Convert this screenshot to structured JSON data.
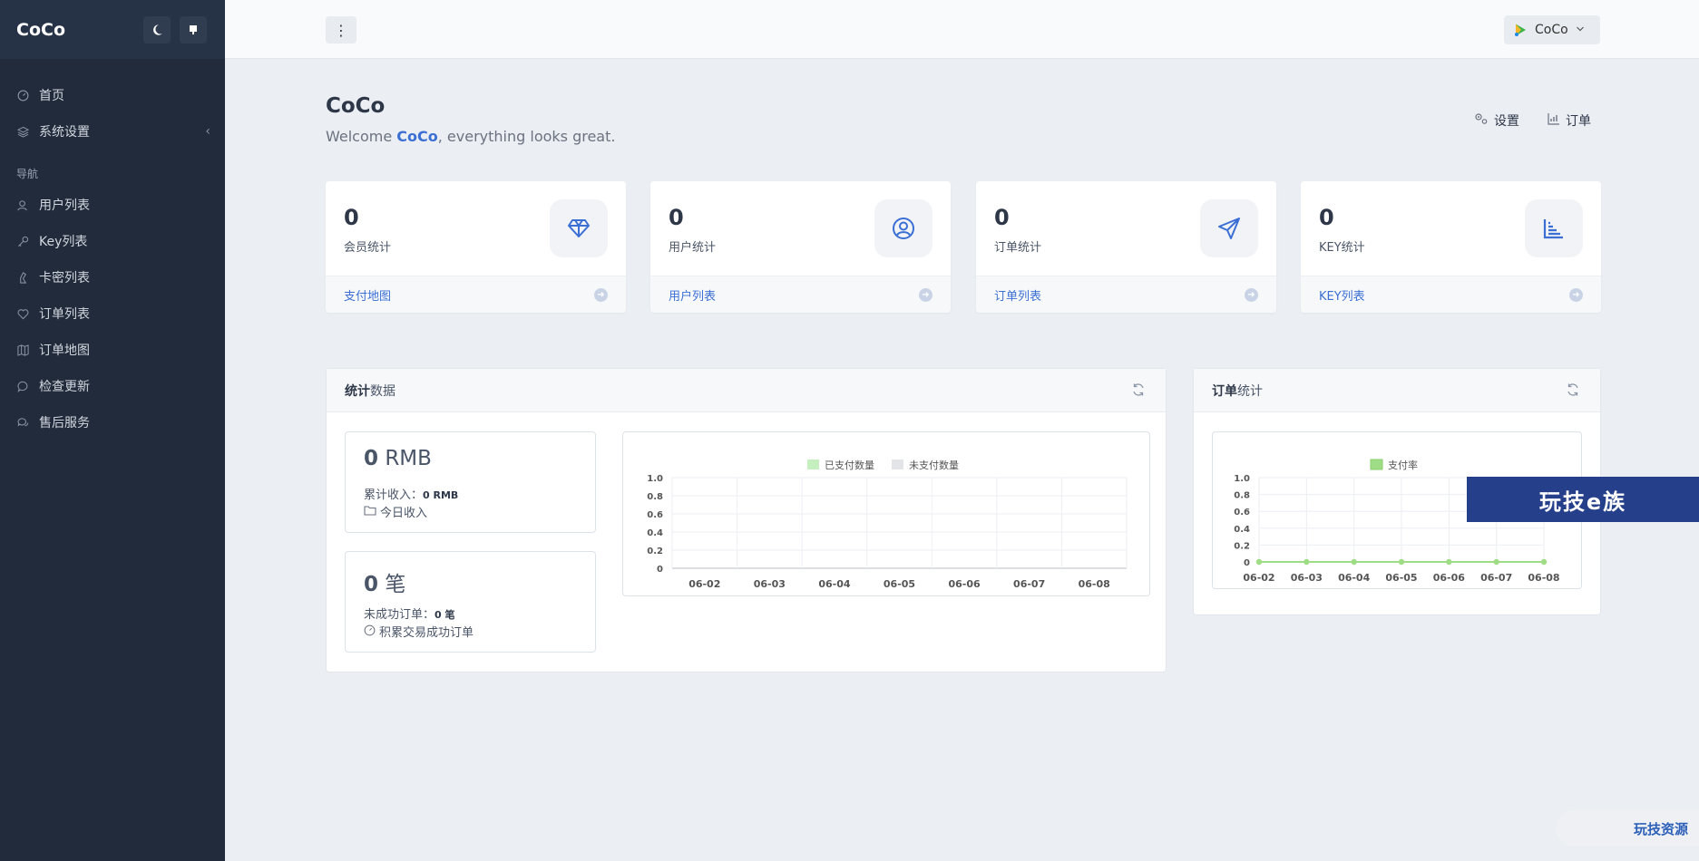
{
  "sidebar": {
    "brand": "CoCo",
    "items_top": [
      {
        "label": "首页",
        "icon": "dashboard-icon"
      },
      {
        "label": "系统设置",
        "icon": "layers-icon"
      }
    ],
    "section_label": "导航",
    "items_nav": [
      {
        "label": "用户列表",
        "icon": "users-icon"
      },
      {
        "label": "Key列表",
        "icon": "key-icon"
      },
      {
        "label": "卡密列表",
        "icon": "ticket-icon"
      },
      {
        "label": "订单列表",
        "icon": "heart-icon"
      },
      {
        "label": "订单地图",
        "icon": "map-icon"
      },
      {
        "label": "检查更新",
        "icon": "chat-icon"
      },
      {
        "label": "售后服务",
        "icon": "chat-bubbles-icon"
      }
    ]
  },
  "topbar": {
    "user_name": "CoCo"
  },
  "header": {
    "title": "CoCo",
    "welcome_prefix": "Welcome ",
    "welcome_name": "CoCo",
    "welcome_suffix": ", everything looks great.",
    "settings_link": "设置",
    "orders_link": "订单"
  },
  "stats": [
    {
      "value": "0",
      "label": "会员统计",
      "link": "支付地图",
      "icon": "diamond-icon"
    },
    {
      "value": "0",
      "label": "用户统计",
      "link": "用户列表",
      "icon": "user-circle-icon"
    },
    {
      "value": "0",
      "label": "订单统计",
      "link": "订单列表",
      "icon": "paper-plane-icon"
    },
    {
      "value": "0",
      "label": "KEY统计",
      "link": "KEY列表",
      "icon": "bar-chart-icon"
    }
  ],
  "stats_panel": {
    "title_bold": "统计",
    "title_rest": "数据",
    "income": {
      "big_value": "0",
      "big_unit": "RMB",
      "total_label": "累计收入：",
      "total_value": "0 RMB",
      "sub_label": "今日收入"
    },
    "orders": {
      "big_value": "0",
      "big_unit": "笔",
      "failed_label": "未成功订单：",
      "failed_value": "0 笔",
      "sub_label": "积累交易成功订单"
    }
  },
  "order_panel": {
    "title_bold": "订单",
    "title_rest": "统计"
  },
  "chart_data": [
    {
      "type": "bar",
      "categories": [
        "06-02",
        "06-03",
        "06-04",
        "06-05",
        "06-06",
        "06-07",
        "06-08"
      ],
      "series": [
        {
          "name": "已支付数量",
          "values": [
            0,
            0,
            0,
            0,
            0,
            0,
            0
          ],
          "color": "#c6efbf"
        },
        {
          "name": "未支付数量",
          "values": [
            0,
            0,
            0,
            0,
            0,
            0,
            0
          ],
          "color": "#e2e4e8"
        }
      ],
      "ylim": [
        0,
        1.0
      ],
      "yticks": [
        "1.0",
        "0.8",
        "0.6",
        "0.4",
        "0.2",
        "0"
      ],
      "legend": "top-center",
      "grid": true
    },
    {
      "type": "line",
      "categories": [
        "06-02",
        "06-03",
        "06-04",
        "06-05",
        "06-06",
        "06-07",
        "06-08"
      ],
      "series": [
        {
          "name": "支付率",
          "values": [
            0,
            0,
            0,
            0,
            0,
            0,
            0
          ],
          "color": "#9fdc86"
        }
      ],
      "ylim": [
        0,
        1.0
      ],
      "yticks": [
        "1.0",
        "0.8",
        "0.6",
        "0.4",
        "0.2",
        "0"
      ],
      "legend": "top-center",
      "grid": true
    }
  ],
  "watermarks": {
    "banner": "玩技e族",
    "corner": "玩技资源"
  }
}
